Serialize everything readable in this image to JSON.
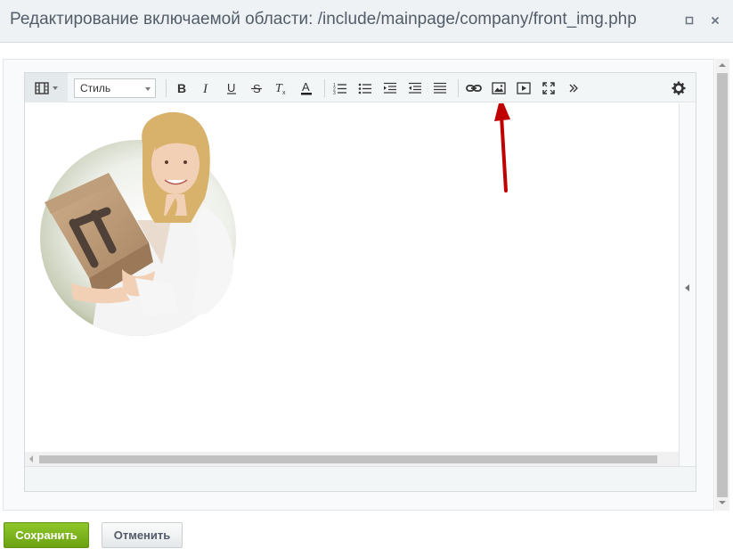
{
  "dialog": {
    "title": "Редактирование включаемой области: /include/mainpage/company/front_img.php"
  },
  "toolbar": {
    "style_select_value": "Стиль",
    "buttons": [
      "bold-icon",
      "italic-icon",
      "underline-icon",
      "strikethrough-icon",
      "remove-format-icon",
      "font-color-icon",
      "ordered-list-icon",
      "unordered-list-icon",
      "outdent-icon",
      "indent-icon",
      "align-justify-icon",
      "link-icon",
      "insert-image-icon",
      "insert-video-icon",
      "fullscreen-icon",
      "more-icon",
      "settings-icon"
    ]
  },
  "editor": {
    "content_image": "woman-holding-box-photo",
    "annotation": "red-arrow-pointing-to-insert-image"
  },
  "footer": {
    "save_label": "Сохранить",
    "cancel_label": "Отменить"
  },
  "colors": {
    "save_green": "#7cb518",
    "annotation_red": "#c00000",
    "titlebar_bg": "#eef2f4"
  }
}
